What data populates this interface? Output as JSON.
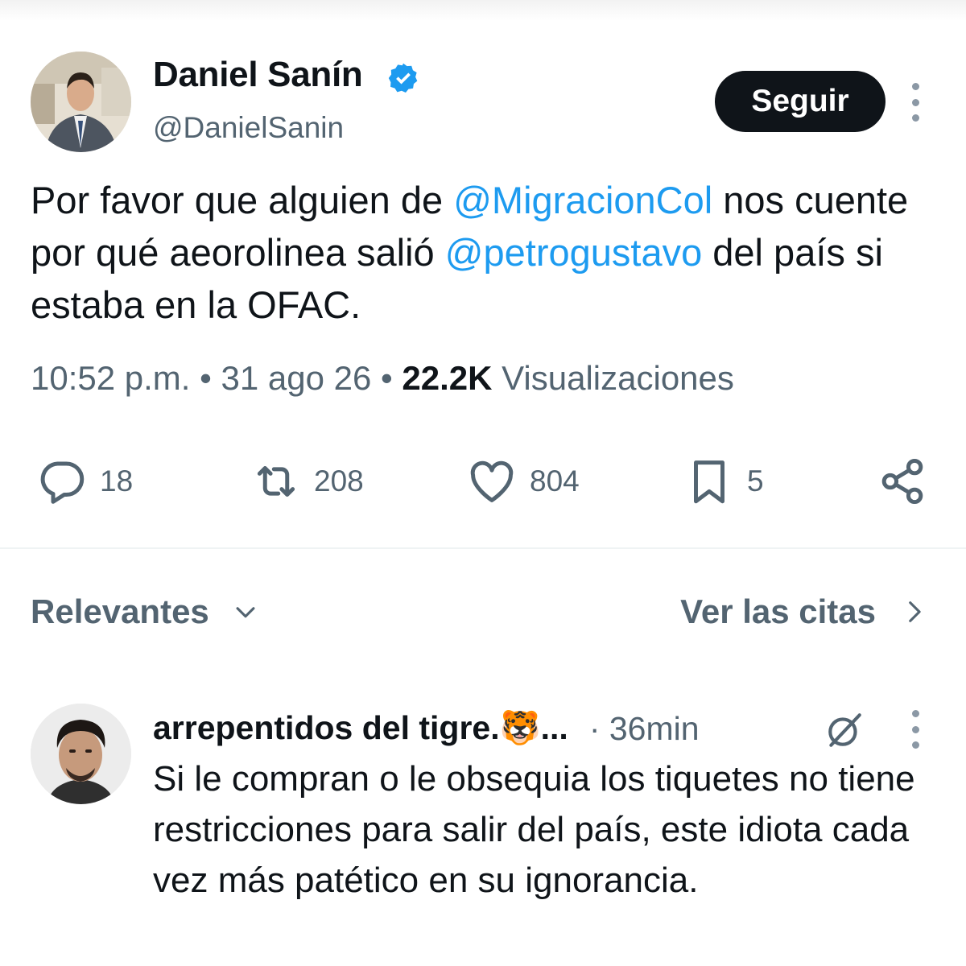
{
  "tweet": {
    "author": {
      "name": "Daniel Sanín",
      "handle": "@DanielSanin",
      "verified": true
    },
    "follow_label": "Seguir",
    "text_segments": [
      {
        "text": "Por favor que alguien de ",
        "type": "text"
      },
      {
        "text": "@MigracionCol",
        "type": "mention"
      },
      {
        "text": " nos cuente por qué aeorolinea salió ",
        "type": "text"
      },
      {
        "text": "@petrogustavo",
        "type": "mention"
      },
      {
        "text": " del país si estaba en la OFAC.",
        "type": "text"
      }
    ],
    "meta": {
      "time": "10:52 p.m.",
      "separator": " • ",
      "date": "31 ago 26",
      "views_count": "22.2K",
      "views_label": "Visualizaciones"
    },
    "actions": {
      "replies": "18",
      "retweets": "208",
      "likes": "804",
      "bookmarks": "5"
    }
  },
  "sort": {
    "label": "Relevantes",
    "quotes_label": "Ver las citas"
  },
  "reply": {
    "name": "arrepentidos del tigre.🐯...",
    "time": "· 36min",
    "text": "Si le compran o le obsequia los tiquetes no tiene restricciones para salir del país, este idiota cada vez más patético en su ignorancia."
  },
  "icons": {
    "verified": "verified-badge-icon",
    "more": "more-vertical-icon",
    "reply": "comment-icon",
    "retweet": "retweet-icon",
    "like": "heart-icon",
    "bookmark": "bookmark-icon",
    "share": "share-icon",
    "chevron_down": "chevron-down-icon",
    "chevron_right": "chevron-right-icon",
    "grok": "grok-icon"
  },
  "colors": {
    "text": "#0f1419",
    "secondary": "#536471",
    "mention": "#1d9bf0",
    "verified": "#1d9bf0",
    "button_bg": "#0f1419"
  }
}
